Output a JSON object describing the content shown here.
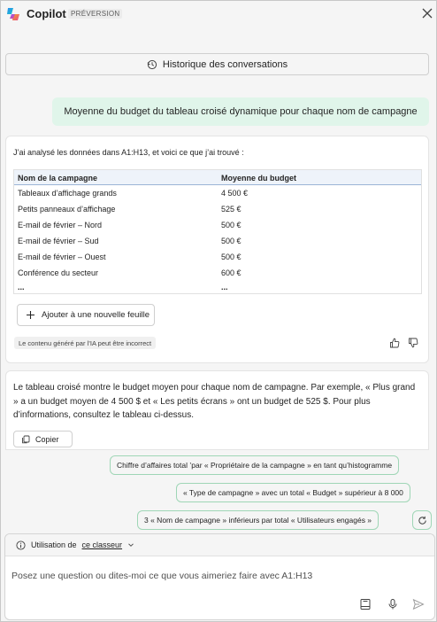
{
  "header": {
    "app_name": "Copilot",
    "badge": "PRÉVERSION",
    "close_icon": "close-icon",
    "logo_icon": "copilot-logo"
  },
  "history_button": {
    "label": "Historique des conversations",
    "icon": "history-icon"
  },
  "user_message": "Moyenne du budget du tableau croisé dynamique pour chaque nom de campagne",
  "response": {
    "intro": "J’ai analysé les données dans A1:H13, et voici ce que j’ai trouvé :",
    "table": {
      "headers": [
        "Nom de la campagne",
        "Moyenne du budget"
      ],
      "rows": [
        [
          "Tableaux d’affichage grands",
          "4 500 €"
        ],
        [
          "Petits panneaux d’affichage",
          "525 €"
        ],
        [
          "E-mail de février – Nord",
          "500 €"
        ],
        [
          "E-mail de février – Sud",
          "500 €"
        ],
        [
          "E-mail de février – Ouest",
          "500 €"
        ],
        [
          "Conférence du secteur",
          "600 €"
        ],
        [
          "...",
          "..."
        ]
      ]
    },
    "add_sheet_label": "Ajouter à une nouvelle feuille",
    "ai_disclaimer": "Le contenu généré par l’IA peut être incorrect"
  },
  "summary": {
    "text": "Le tableau croisé montre le budget moyen pour chaque nom de campagne. Par exemple, « Plus grand » a un budget moyen de 4 500 $ et « Les petits écrans » ont un budget de 525 $. Pour plus d’informations, consultez le tableau ci-dessus.",
    "copy_label": "Copier"
  },
  "suggestions": [
    "Chiffre d’affaires total ’par « Propriétaire de la campagne » en tant qu’histogramme",
    "« Type de campagne » avec un total « Budget » supérieur à 8 000",
    "3 « Nom de campagne » inférieurs par total « Utilisateurs engagés »"
  ],
  "composer": {
    "context_label": "Utilisation de",
    "context_link": "ce classeur",
    "placeholder": "Posez une question ou dites-moi ce que vous aimeriez faire avec A1:H13"
  },
  "colors": {
    "user_bubble": "#e0f5ea",
    "suggestion_border": "#9fd6b6",
    "table_header": "#eef3fa"
  }
}
